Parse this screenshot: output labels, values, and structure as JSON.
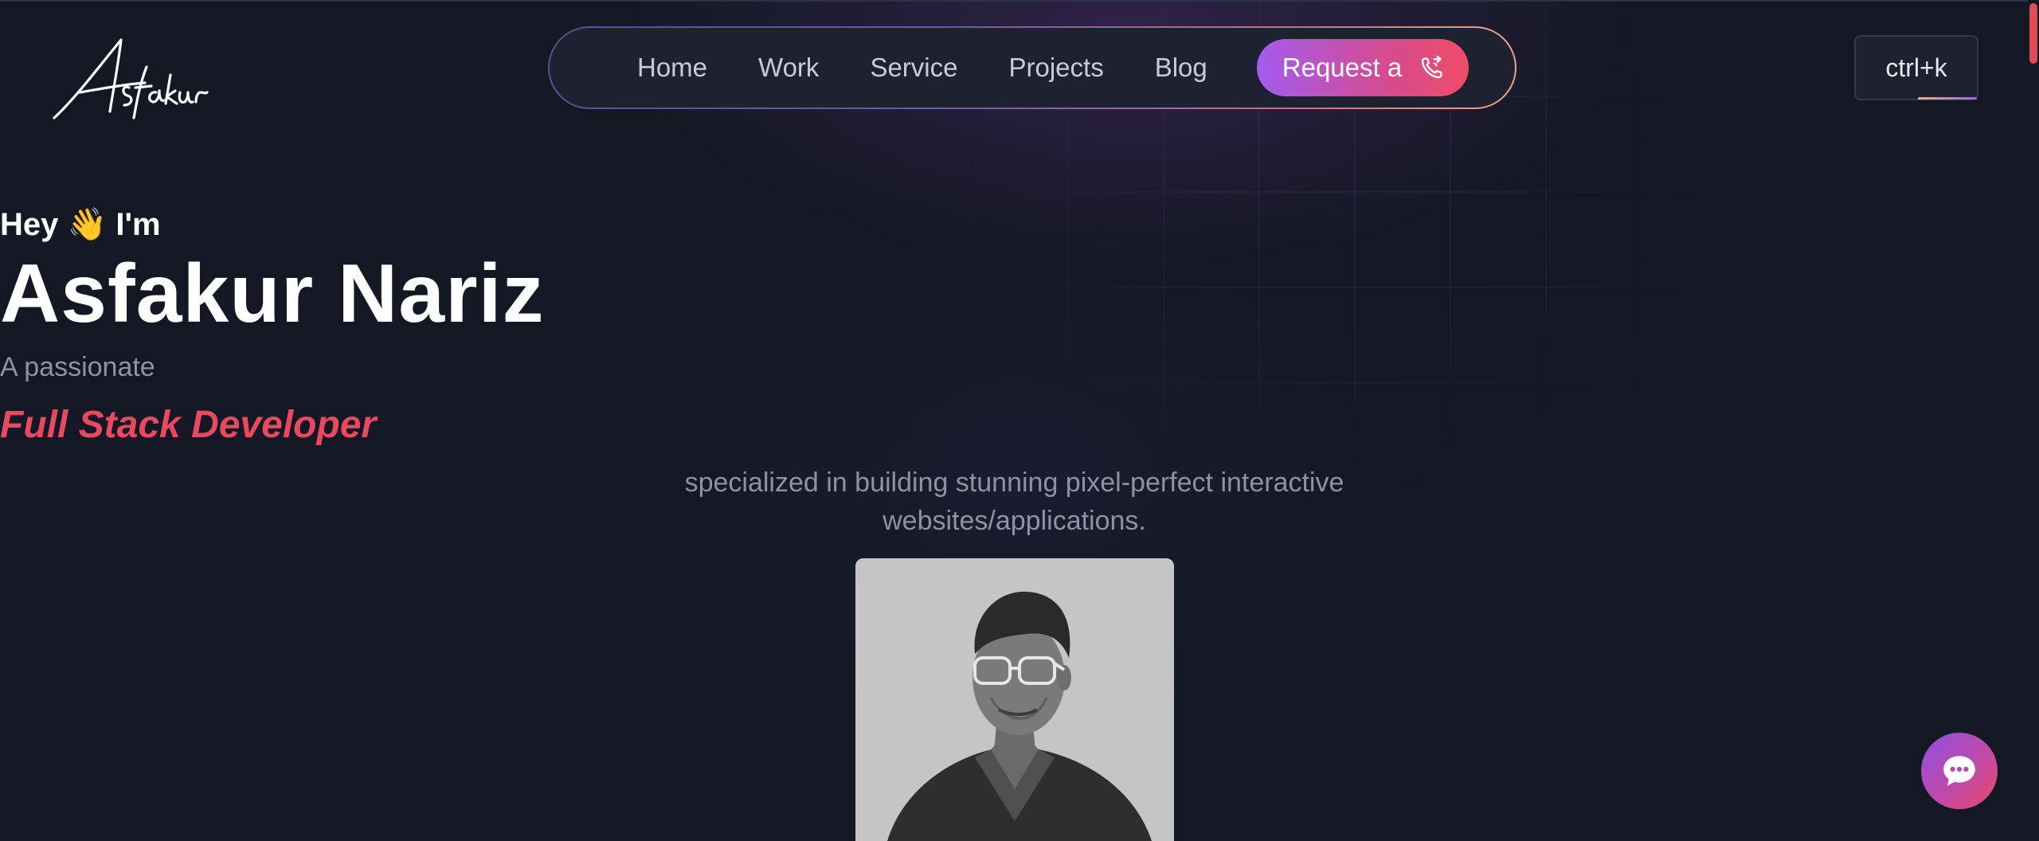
{
  "logo": {
    "text": "Asfakur"
  },
  "nav": {
    "items": [
      {
        "label": "Home"
      },
      {
        "label": "Work"
      },
      {
        "label": "Service"
      },
      {
        "label": "Projects"
      },
      {
        "label": "Blog"
      }
    ],
    "cta_label": "Request a",
    "cta_icon": "phone-call-icon"
  },
  "shortcut": {
    "label": "ctrl+k"
  },
  "hero": {
    "greeting": "Hey 👋 I'm",
    "name": "Asfakur Nariz",
    "intro": "A passionate",
    "role": "Full Stack Developer",
    "description": "specialized in building stunning pixel-perfect interactive websites/applications."
  },
  "colors": {
    "background": "#141824",
    "accent_pink": "#e84860",
    "accent_purple": "#a35cf0",
    "muted_text": "#8d93a3",
    "scrollbar": "#e14a57"
  },
  "chat": {
    "icon": "chat-bubble-icon"
  },
  "photo": {
    "icon": "profile-photo"
  }
}
